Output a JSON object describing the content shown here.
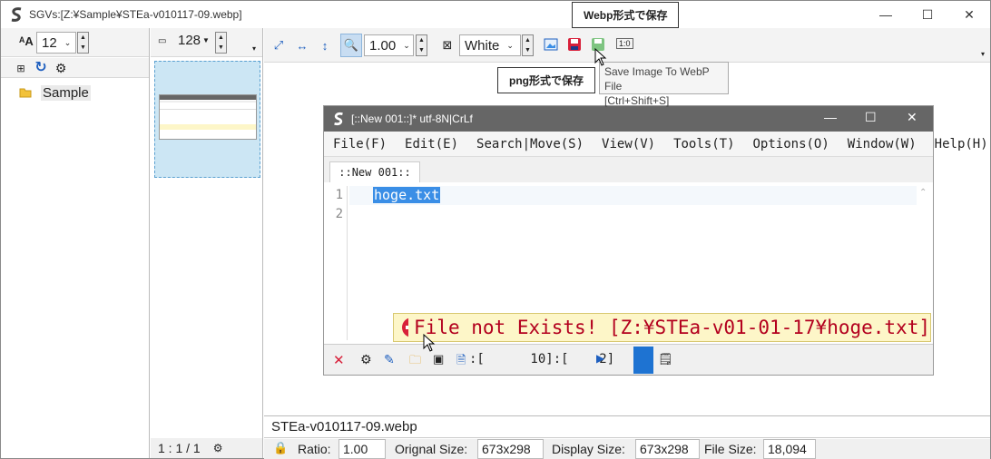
{
  "window": {
    "title": "SGVs:[Z:¥Sample¥STEa-v010117-09.webp]",
    "minimize": "—",
    "maximize": "☐",
    "close": "✕"
  },
  "left_panel": {
    "font_size_icon": "ᴬA",
    "font_size_value": "12",
    "tree_item": "Sample"
  },
  "thumb_panel": {
    "thumb_size": "128",
    "footer_text": "1 : 1 / 1"
  },
  "main_toolbar": {
    "zoom_value": "1.00",
    "bg_value": "White"
  },
  "tooltips": {
    "webp": "Webp形式で保存",
    "png": "png形式で保存",
    "hint_line1": "Save Image To WebP File",
    "hint_line2": "[Ctrl+Shift+S]"
  },
  "inner_window": {
    "title": "[::New 001::]*  utf-8N|CrLf",
    "menu": [
      "File(F)",
      "Edit(E)",
      "Search|Move(S)",
      "View(V)",
      "Tools(T)",
      "Options(O)",
      "Window(W)",
      "Help(H)"
    ],
    "tab": "::New 001::",
    "line_numbers": [
      "1",
      "2"
    ],
    "line1_text": "hoge.txt",
    "error_message": "File not Exists! [Z:¥STEa-v01-01-17¥hoge.txt]",
    "status_pos": ":[      10]:[    2]"
  },
  "status": {
    "filename": "STEa-v010117-09.webp",
    "ratio_label": "Ratio:",
    "ratio_value": "1.00",
    "orig_label": "Orignal Size:",
    "orig_value": "673x298",
    "display_label": "Display Size:",
    "display_value": "673x298",
    "filesize_label": "File Size:",
    "filesize_value": "18,094"
  },
  "colors": {
    "accent": "#1e73d2",
    "selection": "#3a8ee6",
    "thumb_bg": "#cce6f4",
    "error_text": "#b3001e",
    "error_bg": "#fdf6c8"
  }
}
